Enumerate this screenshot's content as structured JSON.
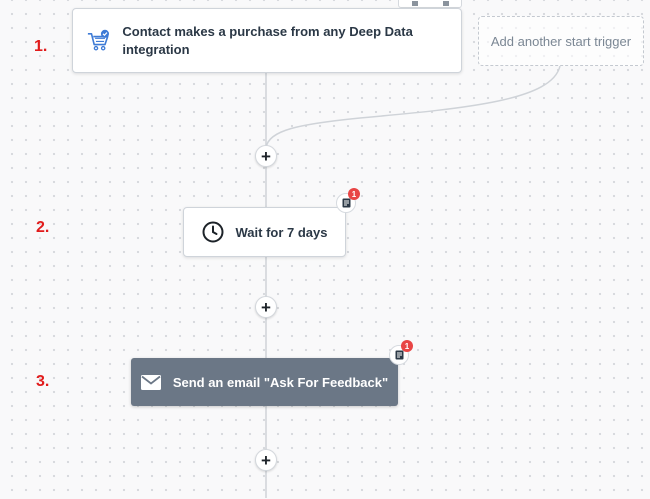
{
  "steps": {
    "step1_number": "1.",
    "step2_number": "2.",
    "step3_number": "3."
  },
  "trigger": {
    "label": "Contact makes a purchase from any Deep Data integration",
    "icon": "cart-check-icon"
  },
  "add_trigger": {
    "label": "Add another start trigger"
  },
  "wait": {
    "label": "Wait for 7 days",
    "icon": "clock-icon",
    "notes_count": "1"
  },
  "email": {
    "label": "Send an email \"Ask For Feedback\"",
    "icon": "envelope-icon",
    "notes_count": "1"
  },
  "add_step_symbol": "+",
  "colors": {
    "step_number": "#e11b1b",
    "email_card_bg": "#6b7786",
    "badge": "#e84545",
    "cart_icon": "#3e7bd6"
  }
}
